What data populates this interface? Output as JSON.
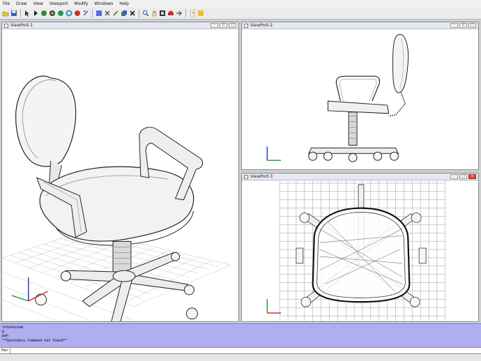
{
  "menu": [
    "File",
    "Draw",
    "View",
    "Viewport",
    "Modify",
    "Windows",
    "Help"
  ],
  "toolbar": {
    "icons": [
      "open-icon",
      "save-icon",
      "select-icon",
      "pointer-icon",
      "sphere-icon",
      "cylinder-icon",
      "cone-icon",
      "torus-icon",
      "box-icon",
      "extrude-icon",
      "rectangle-icon",
      "scissors-icon",
      "wand-icon",
      "layers-icon",
      "transform-icon",
      "zoom-icon",
      "pan-icon",
      "shade-icon",
      "render-icon",
      "arrow-icon",
      "new-icon",
      "help-icon"
    ]
  },
  "viewports": [
    {
      "title": "ViewPort-1"
    },
    {
      "title": "ViewPort-2"
    },
    {
      "title": "ViewPort-3"
    }
  ],
  "console": {
    "lines": [
      "rotateview",
      "p",
      "pan",
      "**Secondary Command not found**"
    ]
  },
  "command": {
    "label": "Pan",
    "value": ""
  },
  "colors": {
    "console_bg": "#aeaef0",
    "axis_x": "#e0282a",
    "axis_y": "#21a82a",
    "axis_z": "#2a3ad8"
  }
}
